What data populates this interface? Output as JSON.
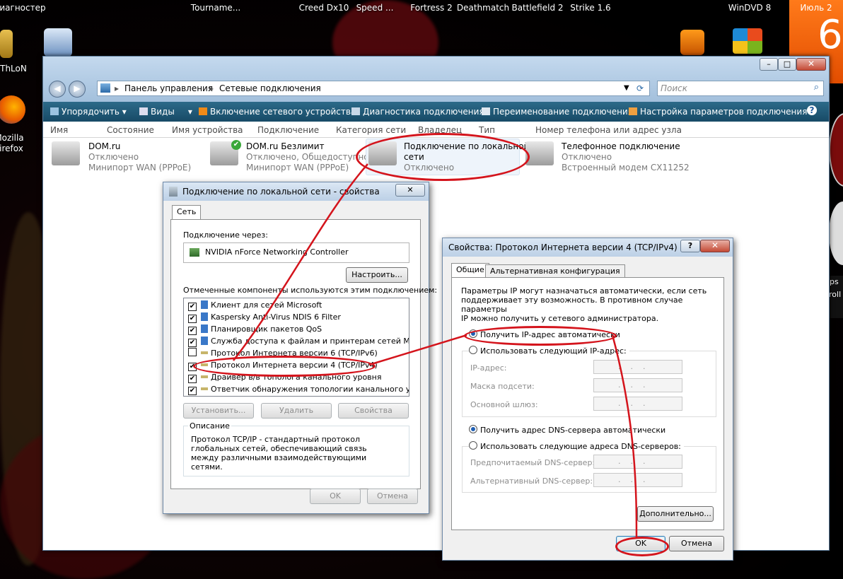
{
  "desktop": {
    "top_labels": [
      "Диагностер",
      "Tourname...",
      "Creed Dx10",
      "Speed ...",
      "Fortress 2",
      "Deathmatch",
      "Battlefield 2",
      "Strike 1.6",
      "WinDVD 8"
    ],
    "left_labels": [
      "ThLoN",
      "Mozilla",
      "Firefox"
    ],
    "calendar_month": "Июль 2",
    "calendar_day": "6",
    "right_text": [
      "ps",
      "roll"
    ]
  },
  "explorer": {
    "address": [
      "Панель управления",
      "Сетевые подключения"
    ],
    "search_placeholder": "Поиск",
    "toolbar": [
      "Упорядочить",
      "Виды",
      "Включение сетевого устройства",
      "Диагностика подключения",
      "Переименование подключения",
      "Настройка параметров подключения"
    ],
    "help_icon": "?",
    "columns": [
      "Имя",
      "Состояние",
      "Имя устройства",
      "Подключение",
      "Категория сети",
      "Владелец",
      "Тип",
      "Номер телефона или адрес узла"
    ],
    "connections": [
      {
        "name": "DOM.ru",
        "status": "Отключено",
        "device": "Минипорт WAN (PPPoE)"
      },
      {
        "name": "DOM.ru Безлимит",
        "status": "Отключено, Общедоступно",
        "device": "Минипорт WAN (PPPoE)"
      },
      {
        "name": "Подключение по локальной",
        "name2": "сети",
        "status": "Отключено",
        "device": ""
      },
      {
        "name": "Телефонное подключение",
        "status": "Отключено",
        "device": "Встроенный модем CX11252"
      }
    ]
  },
  "lan_dialog": {
    "title": "Подключение по локальной сети - свойства",
    "tab": "Сеть",
    "connect_via_label": "Подключение через:",
    "adapter": "NVIDIA nForce Networking Controller",
    "configure_button": "Настроить...",
    "components_label": "Отмеченные компоненты используются этим подключением:",
    "components": [
      {
        "label": "Клиент для сетей Microsoft",
        "checked": "✔"
      },
      {
        "label": "Kaspersky Anti-Virus NDIS 6 Filter",
        "checked": "✔"
      },
      {
        "label": "Планировщик пакетов QoS",
        "checked": "✔"
      },
      {
        "label": "Служба доступа к файлам и принтерам сетей Micro...",
        "checked": "✔"
      },
      {
        "label": "Протокол Интернета версии 6 (TCP/IPv6)",
        "checked": ""
      },
      {
        "label": "Протокол Интернета версии 4 (TCP/IPv4)",
        "checked": "✔"
      },
      {
        "label": "Драйвер в/в тополога канального уровня",
        "checked": "✔"
      },
      {
        "label": "Ответчик обнаружения топологии канального уровня",
        "checked": "✔"
      }
    ],
    "install_button": "Установить...",
    "remove_button": "Удалить",
    "properties_button": "Свойства",
    "description_label": "Описание",
    "description": "Протокол TCP/IP - стандартный протокол глобальных сетей, обеспечивающий связь между различными взаимодействующими сетями.",
    "ok_button": "OK",
    "cancel_button": "Отмена"
  },
  "ipv4_dialog": {
    "title": "Свойства: Протокол Интернета версии 4 (TCP/IPv4)",
    "help": "?",
    "tab_general": "Общие",
    "tab_alt": "Альтернативная конфигурация",
    "intro": [
      "Параметры IP могут назначаться автоматически, если сеть",
      "поддерживает эту возможность. В противном случае параметры",
      "IP можно получить у сетевого администратора."
    ],
    "auto_ip": "Получить IP-адрес автоматически",
    "manual_ip": "Использовать следующий IP-адрес:",
    "ip_label": "IP-адрес:",
    "mask_label": "Маска подсети:",
    "gateway_label": "Основной шлюз:",
    "auto_dns": "Получить адрес DNS-сервера автоматически",
    "manual_dns": "Использовать следующие адреса DNS-серверов:",
    "pref_dns_label": "Предпочитаемый DNS-сервер:",
    "alt_dns_label": "Альтернативный DNS-сервер:",
    "ip_placeholder": ".    .    .",
    "advanced_button": "Дополнительно...",
    "ok_button": "OK",
    "cancel_button": "Отмена"
  }
}
